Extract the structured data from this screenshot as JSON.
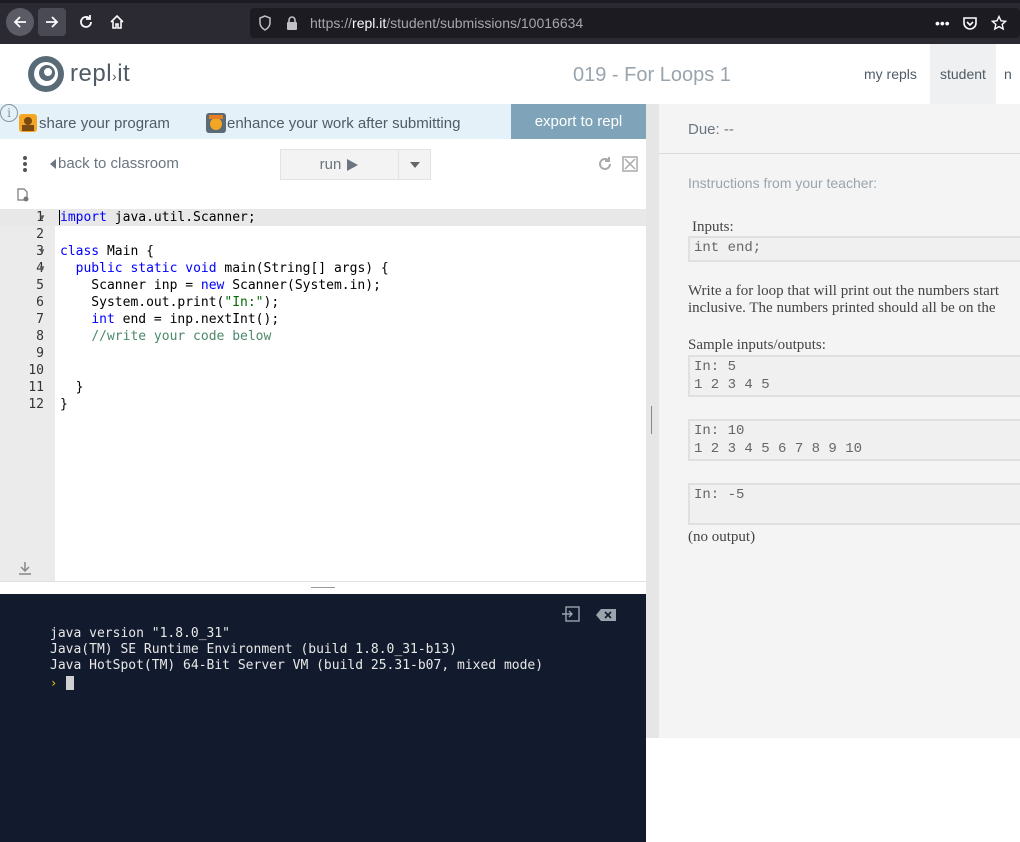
{
  "browser": {
    "url_prefix": "https://",
    "url_host": "repl.it",
    "url_path": "/student/submissions/10016634",
    "more_label": "•••"
  },
  "header": {
    "logo_text": "repl",
    "logo_suffix": "it",
    "page_title": "019 - For Loops 1",
    "nav": {
      "my_repls": "my repls",
      "student": "student",
      "more": "n"
    }
  },
  "toolbar": {
    "share_label": "share your program",
    "enhance_label": "enhance your work after submitting",
    "info_label": "i",
    "export_label": "export to repl",
    "back_label": "back to classroom",
    "run_label": "run"
  },
  "editor": {
    "line_numbers": [
      "1",
      "2",
      "3",
      "4",
      "5",
      "6",
      "7",
      "8",
      "9",
      "10",
      "11",
      "12"
    ],
    "lines": [
      "import java.util.Scanner;",
      "",
      "class Main {",
      "  public static void main(String[] args) {",
      "    Scanner inp = new Scanner(System.in);",
      "    System.out.print(\"In:\");",
      "    int end = inp.nextInt();",
      "    //write your code below",
      "",
      "",
      "  }",
      "}"
    ]
  },
  "console": {
    "lines": [
      "java version \"1.8.0_31\"",
      "Java(TM) SE Runtime Environment (build 1.8.0_31-b13)",
      "Java HotSpot(TM) 64-Bit Server VM (build 25.31-b07, mixed mode)"
    ],
    "prompt": "›"
  },
  "instructions": {
    "due": "Due: --",
    "title": "Instructions from your teacher:",
    "inputs_label": "Inputs:",
    "inputs_code": "int end;",
    "para_line1": "Write a for loop that will print out the numbers start",
    "para_line2": "inclusive.  The numbers printed should all be on the",
    "sample_label": "Sample inputs/outputs:",
    "samples": [
      "In: 5\n1 2 3 4 5",
      "In: 10\n1 2 3 4 5 6 7 8 9 10",
      "In: -5\n "
    ],
    "no_output": "(no output)"
  }
}
